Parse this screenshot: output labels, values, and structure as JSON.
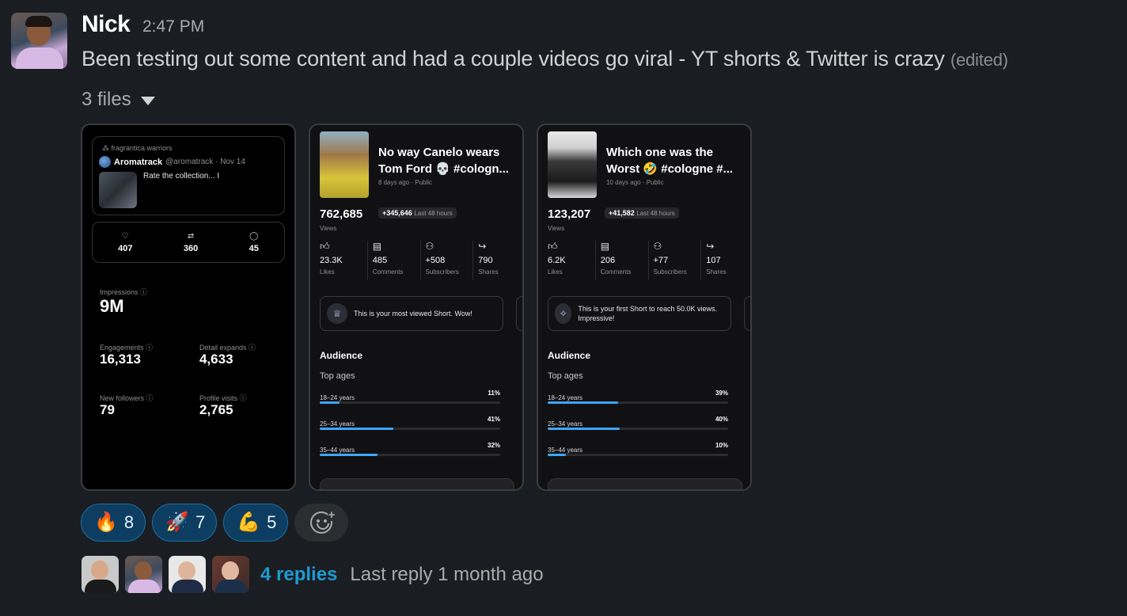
{
  "message": {
    "author": "Nick",
    "time": "2:47 PM",
    "text": "Been testing out some content and had a couple videos go viral - YT shorts & Twitter is crazy",
    "edited": "(edited)"
  },
  "files": {
    "label": "3 files"
  },
  "twitter_card": {
    "community": "fragrantica warriors",
    "name": "Aromatrack",
    "handle": "@aromatrack · Nov 14",
    "text": "Rate the collection... I",
    "likes": "407",
    "retweets": "360",
    "replies": "45",
    "impressions_label": "Impressions",
    "impressions": "9M",
    "engagements_label": "Engagements",
    "engagements": "16,313",
    "detail_label": "Detail expands",
    "detail": "4,633",
    "followers_label": "New followers",
    "followers": "79",
    "profile_label": "Profile visits",
    "profile": "2,765"
  },
  "yt_cards": [
    {
      "title_line1": "No way Canelo wears",
      "title_line2": "Tom Ford 💀 #cologn...",
      "meta": "8 days ago · Public",
      "views": "762,685",
      "delta": "+345,646",
      "delta_sub": "Last 48 hours",
      "views_label": "Views",
      "likes": "23.3K",
      "likes_label": "Likes",
      "comments": "485",
      "comments_label": "Comments",
      "subs": "+508",
      "subs_label": "Subscribers",
      "shares": "790",
      "shares_label": "Shares",
      "banner": "This is your most viewed Short. Wow!",
      "audience": "Audience",
      "top_ages": "Top ages",
      "ages": [
        {
          "label": "18–24 years",
          "pct": "11%",
          "value": 11
        },
        {
          "label": "25–34 years",
          "pct": "41%",
          "value": 41
        },
        {
          "label": "35–44 years",
          "pct": "32%",
          "value": 32
        }
      ]
    },
    {
      "title_line1": "Which one was the",
      "title_line2": "Worst 🤣 #cologne #...",
      "meta": "10 days ago · Public",
      "views": "123,207",
      "delta": "+41,582",
      "delta_sub": "Last 48 hours",
      "views_label": "Views",
      "likes": "6.2K",
      "likes_label": "Likes",
      "comments": "206",
      "comments_label": "Comments",
      "subs": "+77",
      "subs_label": "Subscribers",
      "shares": "107",
      "shares_label": "Shares",
      "banner": "This is your first Short to reach 50.0K views. Impressive!",
      "audience": "Audience",
      "top_ages": "Top ages",
      "ages": [
        {
          "label": "18–24 years",
          "pct": "39%",
          "value": 39
        },
        {
          "label": "25–34 years",
          "pct": "40%",
          "value": 40
        },
        {
          "label": "35–44 years",
          "pct": "10%",
          "value": 10
        }
      ]
    }
  ],
  "reactions": [
    {
      "emoji": "🔥",
      "count": "8"
    },
    {
      "emoji": "🚀",
      "count": "7"
    },
    {
      "emoji": "💪",
      "count": "5"
    }
  ],
  "thread": {
    "replies": "4 replies",
    "last_reply": "Last reply 1 month ago"
  }
}
